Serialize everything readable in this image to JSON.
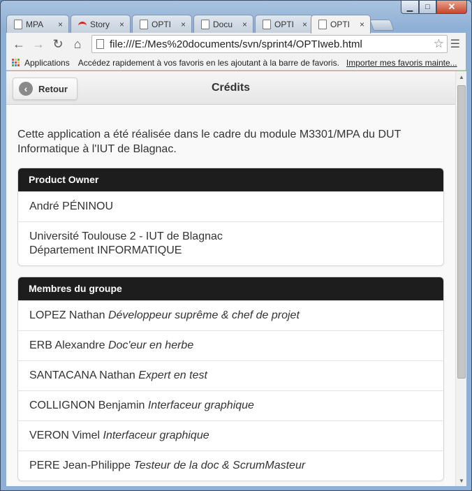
{
  "tabs": [
    {
      "title": "MPA",
      "icon": "page-icon"
    },
    {
      "title": "Story",
      "icon": "arc-icon"
    },
    {
      "title": "OPTI",
      "icon": "page-icon"
    },
    {
      "title": "Docu",
      "icon": "page-icon"
    },
    {
      "title": "OPTI",
      "icon": "page-icon"
    },
    {
      "title": "OPTI",
      "icon": "page-icon"
    }
  ],
  "tab_close": "×",
  "window_controls": {
    "minimize": "▁",
    "maximize": "□",
    "close": "✕"
  },
  "address_bar": {
    "url": "file:///E:/Mes%20documents/svn/sprint4/OPTIweb.html"
  },
  "bookmarks": {
    "apps_label": "Applications",
    "hint": "Accédez rapidement à vos favoris en les ajoutant à la barre de favoris.",
    "import_link": "Importer mes favoris mainte..."
  },
  "page": {
    "back_label": "Retour",
    "title": "Crédits",
    "intro": "Cette application a été réalisée dans le cadre du module M3301/MPA du DUT Informatique à l'IUT de Blagnac.",
    "product_owner": {
      "header": "Product Owner",
      "name": "André PÉNINOU",
      "affiliation_line1": "Université Toulouse 2 - IUT de Blagnac",
      "affiliation_line2": "Département INFORMATIQUE"
    },
    "members": {
      "header": "Membres du groupe",
      "items": [
        {
          "name": "LOPEZ Nathan",
          "role": "Développeur suprême & chef de projet"
        },
        {
          "name": "ERB Alexandre",
          "role": "Doc'eur en herbe"
        },
        {
          "name": "SANTACANA Nathan",
          "role": "Expert en test"
        },
        {
          "name": "COLLIGNON Benjamin",
          "role": "Interfaceur graphique"
        },
        {
          "name": "VERON Vimel",
          "role": "Interfaceur graphique"
        },
        {
          "name": "PERE Jean-Philippe",
          "role": "Testeur de la doc & ScrumMasteur"
        }
      ]
    }
  },
  "colors": {
    "divider_bg": "#1d1d1d",
    "page_bg": "#f9f9f9",
    "window_frame": "#8fb0d6"
  }
}
